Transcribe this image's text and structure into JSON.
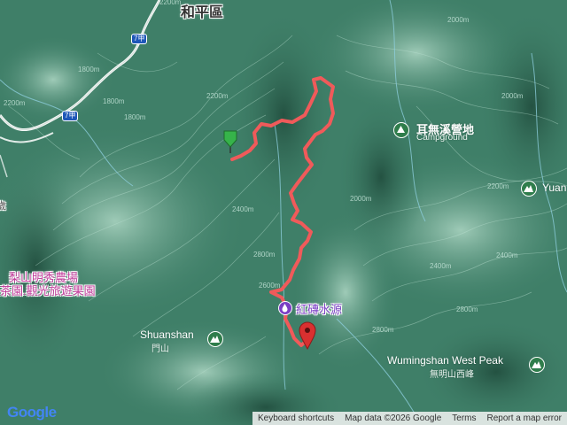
{
  "map": {
    "colors": {
      "terrain": "#3f7f68",
      "ridge": "#9fcbb6",
      "valley": "#2a5f4c",
      "river": "#8fd0e0",
      "road": "#ffffff",
      "route": "#f05a5a",
      "pin_start": "#36b34a",
      "pin_end": "#d93030",
      "poi": "#7b3fc4",
      "park": "#2f7d4b"
    },
    "top_labels": {
      "district": "和平區"
    },
    "roads": [
      {
        "id": "7jia-north",
        "label": "7甲"
      },
      {
        "id": "7jia-west",
        "label": "7甲"
      }
    ],
    "pois": {
      "campground_zh": "耳無溪營地",
      "campground_en": "Campground",
      "yuan_partial": "Yuan",
      "farm_line1": "梨山明秀農場",
      "farm_line2": "茶園.觀光旅遊果園",
      "water_source": "紅磚水源",
      "shuanshan_en": "Shuanshan",
      "shuanshan_zh": "門山",
      "wumingshan_en": "Wumingshan West Peak",
      "wumingshan_zh": "無明山西峰",
      "left_partial": "歲"
    },
    "contours": [
      "2200m",
      "2000m",
      "2200m",
      "1800m",
      "2400m",
      "2000m",
      "2800m",
      "2800m",
      "2400m",
      "2200m",
      "2400m",
      "2000m",
      "2200m",
      "1800m",
      "2600m",
      "2800m",
      "1800m"
    ],
    "pins": {
      "start": "start-pin",
      "end": "end-pin"
    }
  },
  "footer": {
    "logo": "Google",
    "shortcuts": "Keyboard shortcuts",
    "map_data": "Map data ©2026 Google",
    "terms": "Terms",
    "report": "Report a map error"
  }
}
